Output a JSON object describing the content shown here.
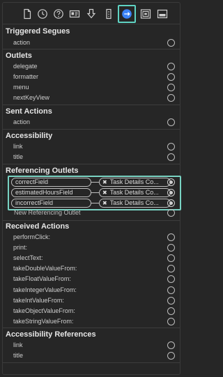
{
  "toolbar": {
    "buttons": [
      {
        "icon": "file-inspector-icon"
      },
      {
        "icon": "history-icon"
      },
      {
        "icon": "quick-help-icon"
      },
      {
        "icon": "identity-inspector-icon"
      },
      {
        "icon": "attributes-inspector-icon"
      },
      {
        "icon": "size-inspector-icon"
      },
      {
        "icon": "connections-inspector-icon",
        "selected": true
      },
      {
        "icon": "bindings-inspector-icon"
      },
      {
        "icon": "view-effects-inspector-icon"
      }
    ],
    "accent_color": "#5fd3c3"
  },
  "sections": {
    "triggered_segues": {
      "title": "Triggered Segues",
      "items": [
        "action"
      ]
    },
    "outlets": {
      "title": "Outlets",
      "items": [
        "delegate",
        "formatter",
        "menu",
        "nextKeyView"
      ]
    },
    "sent_actions": {
      "title": "Sent Actions",
      "items": [
        "action"
      ]
    },
    "accessibility": {
      "title": "Accessibility",
      "items": [
        "link",
        "title"
      ]
    },
    "referencing_outlets": {
      "title": "Referencing Outlets",
      "connections": [
        {
          "outlet": "correctField",
          "target": "Task Details Co..."
        },
        {
          "outlet": "estimatedHoursField",
          "target": "Task Details Co..."
        },
        {
          "outlet": "incorrectField",
          "target": "Task Details Co..."
        }
      ],
      "new_label": "New Referencing Outlet"
    },
    "received_actions": {
      "title": "Received Actions",
      "items": [
        "performClick:",
        "print:",
        "selectText:",
        "takeDoubleValueFrom:",
        "takeFloatValueFrom:",
        "takeIntegerValueFrom:",
        "takeIntValueFrom:",
        "takeObjectValueFrom:",
        "takeStringValueFrom:"
      ]
    },
    "accessibility_references": {
      "title": "Accessibility References",
      "items": [
        "link",
        "title"
      ]
    }
  },
  "remove_glyph": "✖"
}
